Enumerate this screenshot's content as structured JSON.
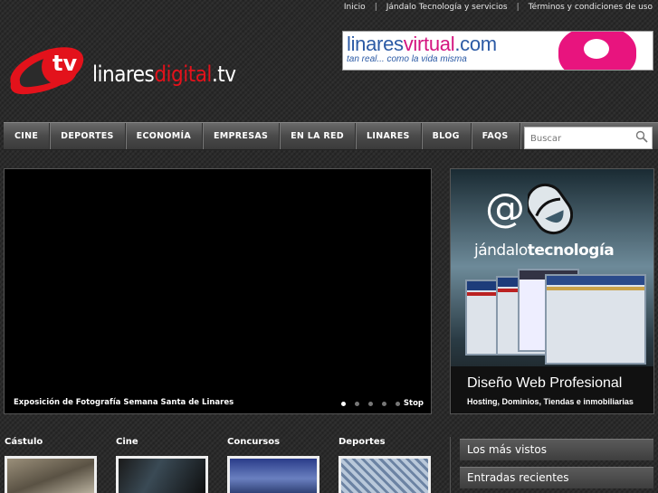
{
  "toplinks": {
    "items": [
      "Inicio",
      "Jándalo Tecnología y servicios",
      "Términos y condiciones de uso"
    ],
    "separator": "|"
  },
  "logo": {
    "badge": "tv",
    "text_prefix": "linares",
    "text_accent": "digital",
    "text_suffix": ".tv"
  },
  "banner_top": {
    "title_prefix": "linares",
    "title_accent": "virtual",
    "title_suffix": ".com",
    "subtitle": "tan real... como la vida misma"
  },
  "nav": {
    "items": [
      "CINE",
      "DEPORTES",
      "ECONOMÍA",
      "EMPRESAS",
      "EN LA RED",
      "LINARES",
      "BLOG",
      "FAQS"
    ]
  },
  "search": {
    "placeholder": "Buscar"
  },
  "video": {
    "caption": "Exposición de Fotografía Semana Santa de Linares",
    "slides_total": 5,
    "active_slide": 1,
    "stop_label": "Stop"
  },
  "side_banner": {
    "at_symbol": "@",
    "brand_prefix": "jándalo",
    "brand_accent": "tecnología",
    "title": "Diseño Web Profesional",
    "subtitle": "Hosting, Dominios, Tiendas e inmobiliarias"
  },
  "categories": [
    "Cástulo",
    "Cine",
    "Concursos",
    "Deportes"
  ],
  "widgets": [
    "Los más vistos",
    "Entradas recientes"
  ],
  "colors": {
    "accent_red": "#e3121b",
    "pink": "#e8147e",
    "blue": "#2b5aa5"
  }
}
